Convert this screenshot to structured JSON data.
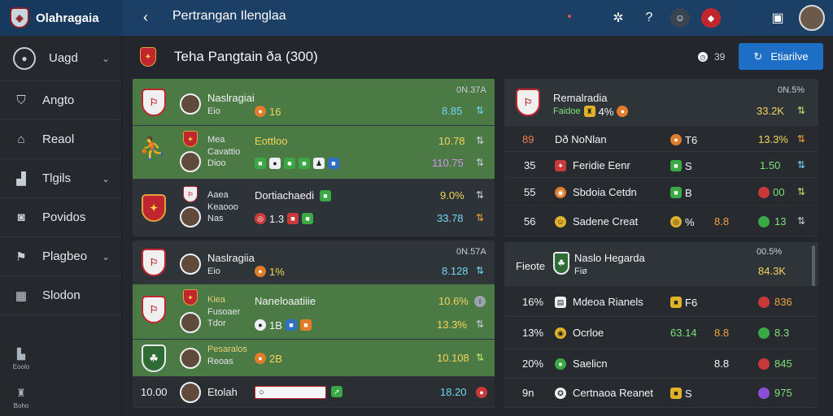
{
  "app": {
    "title": "Olahragaia"
  },
  "topbar": {
    "heading": "Pertrangan Ilenglaa"
  },
  "sidebar": {
    "items": [
      {
        "label": "Uagd",
        "icon": "ball-icon",
        "has_chevron": true
      },
      {
        "label": "Angto",
        "icon": "shield-icon",
        "has_chevron": false
      },
      {
        "label": "Reaol",
        "icon": "home-icon",
        "has_chevron": false
      },
      {
        "label": "Tlgils",
        "icon": "chart-icon",
        "has_chevron": true
      },
      {
        "label": "Povidos",
        "icon": "video-icon",
        "has_chevron": false
      },
      {
        "label": "Plagbeo",
        "icon": "flag-icon",
        "has_chevron": true
      },
      {
        "label": "Slodon",
        "icon": "stadium-icon",
        "has_chevron": false
      }
    ],
    "mini": [
      {
        "label": "Eoolo"
      },
      {
        "label": "Boho"
      }
    ]
  },
  "subheader": {
    "title": "Teha Pangtain ða (300)",
    "timer": "39",
    "cta_label": "Etiarilve"
  },
  "left_top": {
    "header": {
      "team": "Naslragiai",
      "sub": "Eio",
      "badge_value": "16",
      "corner": "0N.37A",
      "value": "8.85"
    },
    "row1": {
      "name_a": "Mea",
      "name_b": "Cavattio",
      "name_c": "Dioo",
      "label": "Eottloo",
      "value": "10.78",
      "value2": "110.75"
    },
    "row2": {
      "name_a": "Aaea",
      "name_b": "Keaooo",
      "name_c": "Nas",
      "label": "Dortiachaedi",
      "badge": "1.3",
      "value": "9.0%",
      "value2": "33.78"
    }
  },
  "right_top": {
    "header": {
      "team": "Remalradia",
      "sub": "Faidoe",
      "badge": "4%",
      "corner": "0N.5%",
      "value": "33.2K"
    },
    "rows": [
      {
        "num": "89",
        "name": "Dð NoNlan",
        "stat": "T6",
        "value": "13.3%"
      },
      {
        "num": "35",
        "name": "Feridie Eenr",
        "stat": "S",
        "value": "1.50"
      },
      {
        "num": "55",
        "name": "Sbdoia Cetdn",
        "stat": "B",
        "value": "00"
      },
      {
        "num": "56",
        "name": "Sadene Creat",
        "stat": "%",
        "value": "13",
        "extra": "8.8"
      }
    ]
  },
  "left_bottom": {
    "header": {
      "team": "Naslragiia",
      "sub": "Eio",
      "badge_value": "1%",
      "corner": "0N.57A",
      "value": "8.128"
    },
    "row1": {
      "name_a": "Kiea",
      "name_b": "Fusoaer",
      "name_c": "Tdor",
      "label": "Naneloaatiiie",
      "badge": "1B",
      "value": "10.6%",
      "value2": "13.3%"
    },
    "row2": {
      "name_a": "Pesaralos",
      "name_b": "Reoas",
      "badge": "2B",
      "value": "10.108"
    },
    "row3": {
      "num": "10.00",
      "name": "Etolah",
      "value": "18.20"
    }
  },
  "right_bottom": {
    "header": {
      "title": "Fieote",
      "team": "Naslo Hegarda",
      "sub": "Fiø",
      "corner": "00.5%",
      "value": "84.3K"
    },
    "rows": [
      {
        "num": "16%",
        "name": "Mdeoa Rianels",
        "stat": "F6",
        "value": "836"
      },
      {
        "num": "13%",
        "name": "Ocrloe",
        "stat": "63.14",
        "extra": "8.8",
        "value": "8.3"
      },
      {
        "num": "20%",
        "name": "Saelicn",
        "extra": "8.8",
        "value": "845"
      },
      {
        "num": "9n",
        "name": "Certnaoa Reanet",
        "stat": "S",
        "value": "975"
      }
    ]
  }
}
